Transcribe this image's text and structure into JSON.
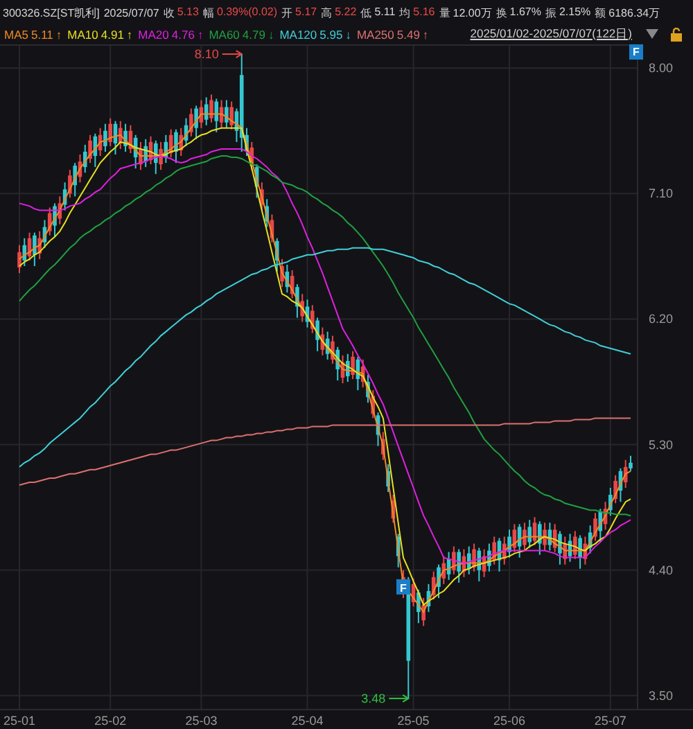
{
  "quote": {
    "symbol": "300326.SZ[ST凯利]",
    "date": "2025/07/07",
    "fields": [
      {
        "label": "收",
        "value": "5.13",
        "kind": "up"
      },
      {
        "label": "幅",
        "value": "0.39%(0.02)",
        "kind": "up"
      },
      {
        "label": "开",
        "value": "5.17",
        "kind": "up"
      },
      {
        "label": "高",
        "value": "5.22",
        "kind": "up"
      },
      {
        "label": "低",
        "value": "5.11",
        "kind": "plain"
      },
      {
        "label": "均",
        "value": "5.16",
        "kind": "up"
      },
      {
        "label": "量",
        "value": "12.00万",
        "kind": "plain"
      },
      {
        "label": "换",
        "value": "1.67%",
        "kind": "plain"
      },
      {
        "label": "振",
        "value": "2.15%",
        "kind": "plain"
      },
      {
        "label": "额",
        "value": "6186.34万",
        "kind": "plain"
      }
    ]
  },
  "indicators": [
    {
      "value": "5.11",
      "trend": "↑"
    },
    {
      "value": "4.91",
      "trend": "↑"
    },
    {
      "value": "4.76",
      "trend": "↑"
    },
    {
      "value": "4.79",
      "trend": "↓"
    },
    {
      "value": "5.95",
      "trend": "↓"
    },
    {
      "value": "5.49",
      "trend": "↑"
    }
  ],
  "range": "2025/01/02-2025/07/07(122日)",
  "corner_flag": {
    "label": "F"
  },
  "event_flag": {
    "label": "F"
  },
  "chart_data": {
    "type": "candlestick",
    "categories": [
      "25-01",
      null,
      null,
      null,
      null,
      null,
      null,
      null,
      null,
      null,
      null,
      null,
      null,
      null,
      null,
      null,
      null,
      null,
      "25-02",
      null,
      null,
      null,
      null,
      null,
      null,
      null,
      null,
      null,
      null,
      null,
      null,
      null,
      null,
      null,
      null,
      null,
      "25-03",
      null,
      null,
      null,
      null,
      null,
      null,
      null,
      null,
      null,
      null,
      null,
      null,
      null,
      null,
      null,
      null,
      null,
      null,
      null,
      null,
      "25-04",
      null,
      null,
      null,
      null,
      null,
      null,
      null,
      null,
      null,
      null,
      null,
      null,
      null,
      null,
      null,
      null,
      null,
      null,
      null,
      null,
      "25-05",
      null,
      null,
      null,
      null,
      null,
      null,
      null,
      null,
      null,
      null,
      null,
      null,
      null,
      null,
      null,
      null,
      null,
      null,
      "25-06",
      null,
      null,
      null,
      null,
      null,
      null,
      null,
      null,
      null,
      null,
      null,
      null,
      null,
      null,
      null,
      null,
      null,
      null,
      null,
      "25-07",
      null,
      null,
      null,
      null
    ],
    "ohlc": [
      [
        6.57,
        6.73,
        6.53,
        6.68
      ],
      [
        6.73,
        6.78,
        6.58,
        6.62
      ],
      [
        6.65,
        6.82,
        6.62,
        6.78
      ],
      [
        6.8,
        6.82,
        6.58,
        6.66
      ],
      [
        6.67,
        6.83,
        6.63,
        6.78
      ],
      [
        6.86,
        6.91,
        6.71,
        6.75
      ],
      [
        6.83,
        7.0,
        6.8,
        6.96
      ],
      [
        7.01,
        7.03,
        6.79,
        6.87
      ],
      [
        6.92,
        7.08,
        6.88,
        7.03
      ],
      [
        7.13,
        7.18,
        6.98,
        7.02
      ],
      [
        7.1,
        7.27,
        7.07,
        7.23
      ],
      [
        7.3,
        7.32,
        7.08,
        7.16
      ],
      [
        7.22,
        7.38,
        7.18,
        7.33
      ],
      [
        7.4,
        7.45,
        7.25,
        7.29
      ],
      [
        7.35,
        7.52,
        7.32,
        7.48
      ],
      [
        7.51,
        7.53,
        7.29,
        7.37
      ],
      [
        7.41,
        7.57,
        7.37,
        7.52
      ],
      [
        7.55,
        7.6,
        7.4,
        7.44
      ],
      [
        7.47,
        7.64,
        7.44,
        7.6
      ],
      [
        7.6,
        7.62,
        7.38,
        7.46
      ],
      [
        7.46,
        7.62,
        7.42,
        7.57
      ],
      [
        7.55,
        7.6,
        7.4,
        7.44
      ],
      [
        7.42,
        7.59,
        7.39,
        7.55
      ],
      [
        7.5,
        7.52,
        7.28,
        7.36
      ],
      [
        7.31,
        7.47,
        7.27,
        7.42
      ],
      [
        7.44,
        7.49,
        7.29,
        7.33
      ],
      [
        7.34,
        7.51,
        7.31,
        7.47
      ],
      [
        7.46,
        7.48,
        7.24,
        7.32
      ],
      [
        7.31,
        7.47,
        7.27,
        7.42
      ],
      [
        7.47,
        7.52,
        7.32,
        7.36
      ],
      [
        7.39,
        7.56,
        7.36,
        7.52
      ],
      [
        7.54,
        7.56,
        7.32,
        7.4
      ],
      [
        7.41,
        7.57,
        7.37,
        7.52
      ],
      [
        7.59,
        7.64,
        7.44,
        7.48
      ],
      [
        7.54,
        7.71,
        7.51,
        7.67
      ],
      [
        7.71,
        7.73,
        7.49,
        7.57
      ],
      [
        7.61,
        7.77,
        7.57,
        7.72
      ],
      [
        7.74,
        7.79,
        7.59,
        7.63
      ],
      [
        7.64,
        7.81,
        7.61,
        7.77
      ],
      [
        7.76,
        7.78,
        7.54,
        7.62
      ],
      [
        7.61,
        7.77,
        7.57,
        7.72
      ],
      [
        7.72,
        7.77,
        7.57,
        7.61
      ],
      [
        7.59,
        7.76,
        7.56,
        7.72
      ],
      [
        7.69,
        7.71,
        7.47,
        7.55
      ],
      [
        7.95,
        8.1,
        7.4,
        7.5
      ],
      [
        7.52,
        7.57,
        7.37,
        7.41
      ],
      [
        7.3,
        7.47,
        7.27,
        7.43
      ],
      [
        7.29,
        7.31,
        7.07,
        7.15
      ],
      [
        7.02,
        7.18,
        6.98,
        7.13
      ],
      [
        7.01,
        7.06,
        6.86,
        6.9
      ],
      [
        6.78,
        6.95,
        6.75,
        6.91
      ],
      [
        6.76,
        6.78,
        6.54,
        6.62
      ],
      [
        6.47,
        6.63,
        6.43,
        6.58
      ],
      [
        6.54,
        6.59,
        6.39,
        6.43
      ],
      [
        6.38,
        6.55,
        6.35,
        6.51
      ],
      [
        6.43,
        6.45,
        6.21,
        6.29
      ],
      [
        6.22,
        6.38,
        6.18,
        6.33
      ],
      [
        6.29,
        6.34,
        6.14,
        6.18
      ],
      [
        6.13,
        6.3,
        6.1,
        6.26
      ],
      [
        6.19,
        6.21,
        5.97,
        6.05
      ],
      [
        5.98,
        6.14,
        5.94,
        6.09
      ],
      [
        6.06,
        6.11,
        5.91,
        5.95
      ],
      [
        5.91,
        6.08,
        5.88,
        6.04
      ],
      [
        5.98,
        6.0,
        5.76,
        5.84
      ],
      [
        5.78,
        5.94,
        5.74,
        5.89
      ],
      [
        5.9,
        5.95,
        5.75,
        5.79
      ],
      [
        5.8,
        5.97,
        5.77,
        5.93
      ],
      [
        5.91,
        5.93,
        5.69,
        5.77
      ],
      [
        5.75,
        5.91,
        5.71,
        5.86
      ],
      [
        5.75,
        5.8,
        5.6,
        5.64
      ],
      [
        5.52,
        5.69,
        5.49,
        5.65
      ],
      [
        5.51,
        5.53,
        5.29,
        5.37
      ],
      [
        5.23,
        5.39,
        5.19,
        5.34
      ],
      [
        5.11,
        5.16,
        4.96,
        5.0
      ],
      [
        4.77,
        4.94,
        4.74,
        4.9
      ],
      [
        4.64,
        4.66,
        4.42,
        4.5
      ],
      [
        4.24,
        4.4,
        4.2,
        4.35
      ],
      [
        4.3,
        4.35,
        3.48,
        3.75
      ],
      [
        4.17,
        4.34,
        4.14,
        4.3
      ],
      [
        4.24,
        4.26,
        4.02,
        4.1
      ],
      [
        4.04,
        4.2,
        4.0,
        4.15
      ],
      [
        4.25,
        4.3,
        4.1,
        4.14
      ],
      [
        4.22,
        4.39,
        4.19,
        4.35
      ],
      [
        4.42,
        4.44,
        4.2,
        4.28
      ],
      [
        4.34,
        4.5,
        4.3,
        4.45
      ],
      [
        4.48,
        4.53,
        4.33,
        4.37
      ],
      [
        4.4,
        4.57,
        4.37,
        4.53
      ],
      [
        4.53,
        4.55,
        4.31,
        4.39
      ],
      [
        4.39,
        4.55,
        4.35,
        4.5
      ],
      [
        4.52,
        4.57,
        4.37,
        4.41
      ],
      [
        4.42,
        4.59,
        4.39,
        4.55
      ],
      [
        4.54,
        4.56,
        4.32,
        4.4
      ],
      [
        4.39,
        4.55,
        4.35,
        4.5
      ],
      [
        4.54,
        4.59,
        4.39,
        4.43
      ],
      [
        4.47,
        4.64,
        4.44,
        4.6
      ],
      [
        4.61,
        4.63,
        4.39,
        4.47
      ],
      [
        4.48,
        4.64,
        4.44,
        4.59
      ],
      [
        4.64,
        4.69,
        4.49,
        4.53
      ],
      [
        4.56,
        4.73,
        4.53,
        4.69
      ],
      [
        4.71,
        4.73,
        4.49,
        4.57
      ],
      [
        4.58,
        4.74,
        4.54,
        4.69
      ],
      [
        4.71,
        4.76,
        4.56,
        4.6
      ],
      [
        4.61,
        4.78,
        4.58,
        4.74
      ],
      [
        4.73,
        4.75,
        4.51,
        4.59
      ],
      [
        4.58,
        4.74,
        4.54,
        4.69
      ],
      [
        4.69,
        4.74,
        4.54,
        4.58
      ],
      [
        4.56,
        4.73,
        4.53,
        4.69
      ],
      [
        4.66,
        4.68,
        4.44,
        4.52
      ],
      [
        4.48,
        4.64,
        4.44,
        4.59
      ],
      [
        4.61,
        4.66,
        4.46,
        4.5
      ],
      [
        4.51,
        4.68,
        4.48,
        4.64
      ],
      [
        4.63,
        4.65,
        4.41,
        4.49
      ],
      [
        4.48,
        4.64,
        4.44,
        4.59
      ],
      [
        4.67,
        4.72,
        4.52,
        4.56
      ],
      [
        4.64,
        4.81,
        4.61,
        4.77
      ],
      [
        4.82,
        4.84,
        4.6,
        4.68
      ],
      [
        4.73,
        4.89,
        4.69,
        4.84
      ],
      [
        4.94,
        4.99,
        4.79,
        4.83
      ],
      [
        4.91,
        5.08,
        4.88,
        5.04
      ],
      [
        5.11,
        5.13,
        4.89,
        4.97
      ],
      [
        5.03,
        5.19,
        4.99,
        5.14
      ],
      [
        5.17,
        5.22,
        5.11,
        5.13
      ]
    ],
    "series": [
      {
        "name": "MA5",
        "type": "line",
        "color": "#f08a24",
        "values": [
          6.63,
          6.66,
          6.68,
          6.71,
          6.73,
          6.79,
          6.86,
          6.92,
          6.98,
          7.06,
          7.13,
          7.21,
          7.28,
          7.33,
          7.38,
          7.42,
          7.47,
          7.48,
          7.5,
          7.51,
          7.52,
          7.48,
          7.45,
          7.41,
          7.37,
          7.37,
          7.37,
          7.37,
          7.37,
          7.4,
          7.42,
          7.45,
          7.47,
          7.52,
          7.57,
          7.62,
          7.67,
          7.67,
          7.67,
          7.67,
          7.67,
          7.65,
          7.62,
          7.6,
          7.57,
          7.45,
          7.33,
          7.2,
          7.08,
          6.94,
          6.81,
          6.67,
          6.53,
          6.47,
          6.41,
          6.34,
          6.28,
          6.22,
          6.16,
          6.1,
          6.04,
          5.99,
          5.94,
          5.89,
          5.84,
          5.83,
          5.83,
          5.82,
          5.81,
          5.68,
          5.55,
          5.42,
          5.29,
          5.04,
          4.8,
          4.55,
          4.3,
          4.25,
          4.2,
          4.15,
          4.1,
          4.18,
          4.25,
          4.33,
          4.4,
          4.41,
          4.43,
          4.44,
          4.45,
          4.45,
          4.45,
          4.45,
          4.45,
          4.47,
          4.5,
          4.52,
          4.54,
          4.57,
          4.59,
          4.62,
          4.64,
          4.64,
          4.64,
          4.64,
          4.64,
          4.62,
          4.59,
          4.57,
          4.54,
          4.54,
          4.54,
          4.54,
          4.54,
          4.6,
          4.67,
          4.73,
          4.79,
          4.87,
          4.94,
          5.02,
          5.09,
          5.11
        ]
      },
      {
        "name": "MA10",
        "type": "line",
        "color": "#e8e020",
        "values": [
          6.58,
          6.61,
          6.63,
          6.66,
          6.68,
          6.72,
          6.76,
          6.79,
          6.83,
          6.89,
          6.96,
          7.02,
          7.08,
          7.14,
          7.2,
          7.26,
          7.32,
          7.36,
          7.4,
          7.43,
          7.47,
          7.46,
          7.45,
          7.43,
          7.42,
          7.41,
          7.4,
          7.38,
          7.37,
          7.38,
          7.4,
          7.41,
          7.42,
          7.45,
          7.47,
          7.5,
          7.52,
          7.53,
          7.55,
          7.56,
          7.57,
          7.57,
          7.57,
          7.57,
          7.57,
          7.42,
          7.28,
          7.13,
          6.98,
          6.83,
          6.68,
          6.53,
          6.38,
          6.36,
          6.33,
          6.31,
          6.28,
          6.22,
          6.16,
          6.1,
          6.04,
          6.0,
          5.96,
          5.92,
          5.88,
          5.86,
          5.84,
          5.81,
          5.79,
          5.72,
          5.64,
          5.57,
          5.49,
          5.24,
          4.99,
          4.74,
          4.49,
          4.41,
          4.32,
          4.24,
          4.15,
          4.18,
          4.2,
          4.23,
          4.25,
          4.29,
          4.33,
          4.36,
          4.4,
          4.41,
          4.43,
          4.44,
          4.45,
          4.46,
          4.47,
          4.48,
          4.49,
          4.5,
          4.52,
          4.53,
          4.54,
          4.57,
          4.59,
          4.62,
          4.64,
          4.63,
          4.62,
          4.6,
          4.59,
          4.58,
          4.57,
          4.55,
          4.54,
          4.57,
          4.59,
          4.62,
          4.64,
          4.7,
          4.77,
          4.83,
          4.89,
          4.91
        ]
      },
      {
        "name": "MA20",
        "type": "line",
        "color": "#e020e0",
        "values": [
          7.03,
          7.02,
          7.01,
          6.99,
          6.98,
          6.98,
          6.98,
          6.98,
          6.98,
          6.99,
          7.01,
          7.02,
          7.03,
          7.06,
          7.08,
          7.11,
          7.13,
          7.17,
          7.21,
          7.24,
          7.28,
          7.29,
          7.3,
          7.31,
          7.32,
          7.33,
          7.35,
          7.36,
          7.37,
          7.36,
          7.35,
          7.33,
          7.32,
          7.33,
          7.35,
          7.36,
          7.37,
          7.38,
          7.4,
          7.41,
          7.42,
          7.42,
          7.42,
          7.42,
          7.42,
          7.4,
          7.37,
          7.35,
          7.32,
          7.29,
          7.25,
          7.22,
          7.18,
          7.11,
          7.03,
          6.96,
          6.88,
          6.79,
          6.71,
          6.62,
          6.53,
          6.43,
          6.33,
          6.23,
          6.13,
          6.07,
          6.01,
          5.94,
          5.88,
          5.81,
          5.74,
          5.66,
          5.59,
          5.49,
          5.39,
          5.29,
          5.19,
          5.09,
          4.99,
          4.89,
          4.79,
          4.72,
          4.64,
          4.57,
          4.49,
          4.48,
          4.47,
          4.46,
          4.45,
          4.46,
          4.47,
          4.48,
          4.49,
          4.5,
          4.52,
          4.53,
          4.54,
          4.54,
          4.54,
          4.54,
          4.54,
          4.54,
          4.54,
          4.54,
          4.54,
          4.53,
          4.52,
          4.5,
          4.49,
          4.49,
          4.49,
          4.49,
          4.49,
          4.53,
          4.57,
          4.6,
          4.64,
          4.67,
          4.69,
          4.72,
          4.74,
          4.76
        ]
      },
      {
        "name": "MA60",
        "type": "line",
        "color": "#20a040",
        "values": [
          6.33,
          6.37,
          6.41,
          6.44,
          6.48,
          6.52,
          6.56,
          6.59,
          6.63,
          6.67,
          6.71,
          6.74,
          6.78,
          6.81,
          6.83,
          6.86,
          6.88,
          6.91,
          6.93,
          6.96,
          6.98,
          7.01,
          7.03,
          7.06,
          7.08,
          7.11,
          7.13,
          7.16,
          7.18,
          7.21,
          7.23,
          7.26,
          7.28,
          7.29,
          7.3,
          7.31,
          7.32,
          7.33,
          7.35,
          7.36,
          7.37,
          7.37,
          7.36,
          7.36,
          7.35,
          7.33,
          7.31,
          7.3,
          7.28,
          7.26,
          7.23,
          7.21,
          7.18,
          7.17,
          7.16,
          7.14,
          7.13,
          7.11,
          7.08,
          7.06,
          7.03,
          7.01,
          6.98,
          6.96,
          6.93,
          6.89,
          6.86,
          6.82,
          6.78,
          6.73,
          6.68,
          6.63,
          6.58,
          6.52,
          6.46,
          6.39,
          6.33,
          6.27,
          6.21,
          6.14,
          6.08,
          6.02,
          5.96,
          5.9,
          5.84,
          5.78,
          5.71,
          5.65,
          5.59,
          5.53,
          5.46,
          5.4,
          5.34,
          5.3,
          5.26,
          5.23,
          5.19,
          5.15,
          5.11,
          5.08,
          5.04,
          5.01,
          4.99,
          4.96,
          4.94,
          4.93,
          4.91,
          4.9,
          4.88,
          4.87,
          4.86,
          4.85,
          4.84,
          4.83,
          4.83,
          4.82,
          4.81,
          4.81,
          4.8,
          4.8,
          4.8,
          4.79
        ]
      },
      {
        "name": "MA120",
        "type": "line",
        "color": "#40d0d8",
        "values": [
          5.14,
          5.17,
          5.19,
          5.22,
          5.24,
          5.27,
          5.31,
          5.34,
          5.37,
          5.4,
          5.43,
          5.46,
          5.49,
          5.53,
          5.57,
          5.6,
          5.64,
          5.68,
          5.72,
          5.75,
          5.79,
          5.83,
          5.86,
          5.9,
          5.93,
          5.97,
          6.01,
          6.04,
          6.08,
          6.11,
          6.14,
          6.17,
          6.2,
          6.23,
          6.25,
          6.28,
          6.3,
          6.33,
          6.35,
          6.38,
          6.4,
          6.42,
          6.44,
          6.46,
          6.48,
          6.5,
          6.52,
          6.53,
          6.55,
          6.56,
          6.58,
          6.59,
          6.6,
          6.61,
          6.63,
          6.64,
          6.65,
          6.66,
          6.66,
          6.67,
          6.68,
          6.69,
          6.69,
          6.7,
          6.7,
          6.7,
          6.71,
          6.71,
          6.71,
          6.71,
          6.7,
          6.7,
          6.7,
          6.69,
          6.68,
          6.67,
          6.66,
          6.65,
          6.64,
          6.62,
          6.61,
          6.6,
          6.58,
          6.57,
          6.55,
          6.53,
          6.52,
          6.5,
          6.48,
          6.46,
          6.45,
          6.43,
          6.41,
          6.39,
          6.37,
          6.35,
          6.33,
          6.31,
          6.3,
          6.28,
          6.26,
          6.24,
          6.22,
          6.2,
          6.18,
          6.16,
          6.15,
          6.13,
          6.11,
          6.1,
          6.08,
          6.07,
          6.05,
          6.04,
          6.03,
          6.01,
          6.0,
          5.99,
          5.98,
          5.97,
          5.96,
          5.95
        ]
      },
      {
        "name": "MA250",
        "type": "line",
        "color": "#e07070",
        "values": [
          5.01,
          5.02,
          5.03,
          5.03,
          5.04,
          5.05,
          5.06,
          5.06,
          5.07,
          5.08,
          5.09,
          5.09,
          5.1,
          5.11,
          5.12,
          5.12,
          5.13,
          5.14,
          5.15,
          5.16,
          5.17,
          5.18,
          5.19,
          5.2,
          5.21,
          5.22,
          5.23,
          5.23,
          5.24,
          5.25,
          5.26,
          5.26,
          5.27,
          5.28,
          5.29,
          5.3,
          5.31,
          5.32,
          5.33,
          5.33,
          5.34,
          5.35,
          5.35,
          5.36,
          5.36,
          5.37,
          5.37,
          5.38,
          5.38,
          5.39,
          5.39,
          5.4,
          5.4,
          5.41,
          5.41,
          5.42,
          5.42,
          5.42,
          5.43,
          5.43,
          5.43,
          5.43,
          5.44,
          5.44,
          5.44,
          5.44,
          5.44,
          5.44,
          5.44,
          5.44,
          5.44,
          5.44,
          5.44,
          5.44,
          5.44,
          5.44,
          5.44,
          5.44,
          5.44,
          5.44,
          5.44,
          5.44,
          5.44,
          5.44,
          5.44,
          5.44,
          5.44,
          5.44,
          5.44,
          5.44,
          5.44,
          5.44,
          5.44,
          5.44,
          5.44,
          5.44,
          5.45,
          5.45,
          5.45,
          5.45,
          5.45,
          5.45,
          5.46,
          5.46,
          5.46,
          5.46,
          5.47,
          5.47,
          5.47,
          5.47,
          5.48,
          5.48,
          5.48,
          5.48,
          5.49,
          5.49,
          5.49,
          5.49,
          5.49,
          5.49,
          5.49,
          5.49
        ]
      }
    ],
    "ylim": [
      3.4,
      8.17
    ],
    "grid": true,
    "yticks": [
      {
        "value": 8.0,
        "label": "8.00"
      },
      {
        "value": 7.1,
        "label": "7.10"
      },
      {
        "value": 6.2,
        "label": "6.20"
      },
      {
        "value": 5.3,
        "label": "5.30"
      },
      {
        "value": 4.4,
        "label": "4.40"
      },
      {
        "value": 3.5,
        "label": "3.50"
      }
    ],
    "annotations": [
      "8.10",
      "3.48"
    ]
  }
}
